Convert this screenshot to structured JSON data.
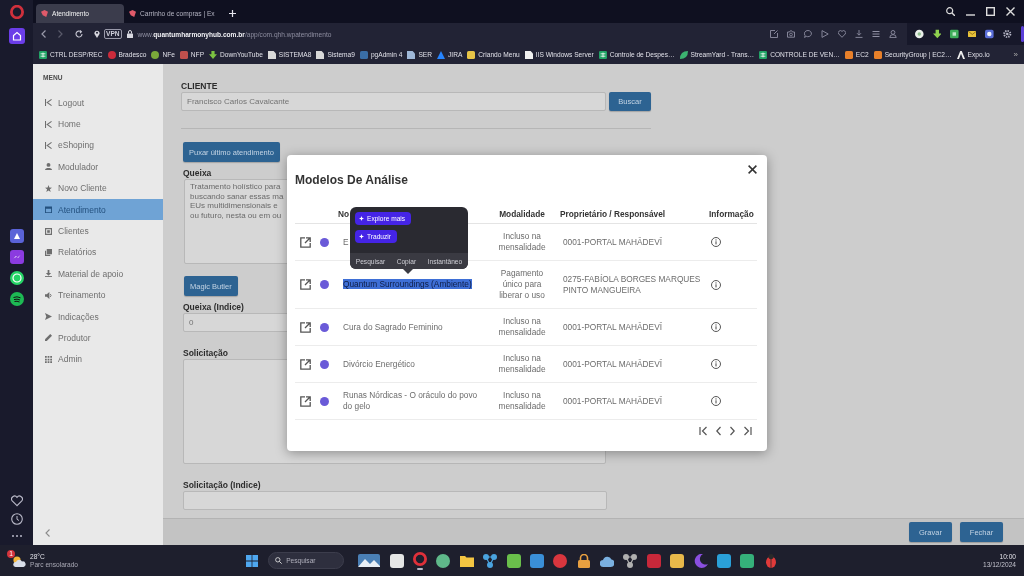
{
  "browser": {
    "tabs": [
      {
        "title": "Atendimento",
        "selected": true
      },
      {
        "title": "Carrinho de compras | Ex",
        "selected": false
      }
    ],
    "vpn": "VPN",
    "url": "www.**quantumharmonyhub.com.br**/app/com.qhh.wpatendimento",
    "bookmarks": [
      {
        "label": "CTRL DESP/REC",
        "kind": "sheet",
        "color": "#21a366"
      },
      {
        "label": "Bradesco",
        "kind": "disc",
        "color": "#cc2b3b"
      },
      {
        "label": "NFe",
        "kind": "disc",
        "color": "#7aa83a"
      },
      {
        "label": "NFP",
        "kind": "tile",
        "color": "#c0504d"
      },
      {
        "label": "DownYouTube",
        "kind": "arrow",
        "color": "#7cc242"
      },
      {
        "label": "SISTEMA8",
        "kind": "doc",
        "color": "#d8d8d8"
      },
      {
        "label": "Sistema9",
        "kind": "doc",
        "color": "#d8d8d8"
      },
      {
        "label": "pgAdmin 4",
        "kind": "tile",
        "color": "#3a6ea8"
      },
      {
        "label": "SER",
        "kind": "doc",
        "color": "#9fb8d8"
      },
      {
        "label": "JIRA",
        "kind": "triangle",
        "color": "#2684ff"
      },
      {
        "label": "Criando Menu",
        "kind": "tile",
        "color": "#e8c547"
      },
      {
        "label": "IIS Windows Server",
        "kind": "doc",
        "color": "#f0f0f0"
      },
      {
        "label": "Controle de Despes…",
        "kind": "sheet",
        "color": "#21a366"
      },
      {
        "label": "StreamYard - Trans…",
        "kind": "leaf",
        "color": "#3cb371"
      },
      {
        "label": "CONTROLE DE VEN…",
        "kind": "sheet",
        "color": "#21a366"
      },
      {
        "label": "EC2",
        "kind": "tile",
        "color": "#e8802a"
      },
      {
        "label": "SecurityGroup | EC2…",
        "kind": "tile",
        "color": "#e8802a"
      },
      {
        "label": "Expo.io",
        "kind": "caret",
        "color": "#eeeeee"
      }
    ],
    "more": "»"
  },
  "menu": {
    "title": "MENU",
    "items": [
      {
        "label": "Logout",
        "kind": "exit",
        "selected": false
      },
      {
        "label": "Home",
        "kind": "exit",
        "selected": false
      },
      {
        "label": "eShoping",
        "kind": "exit",
        "selected": false
      },
      {
        "label": "Modulador",
        "kind": "user",
        "selected": false
      },
      {
        "label": "Novo Cliente",
        "kind": "star",
        "selected": false
      },
      {
        "label": "Atendimento",
        "kind": "calendar",
        "selected": true
      },
      {
        "label": "Clientes",
        "kind": "card",
        "selected": false
      },
      {
        "label": "Relatórios",
        "kind": "copy",
        "selected": false
      },
      {
        "label": "Material de apoio",
        "kind": "download",
        "selected": false
      },
      {
        "label": "Treinamento",
        "kind": "speaker",
        "selected": false
      },
      {
        "label": "Indicações",
        "kind": "send",
        "selected": false
      },
      {
        "label": "Produtor",
        "kind": "pencil",
        "selected": false
      },
      {
        "label": "Admin",
        "kind": "grid",
        "selected": false
      }
    ]
  },
  "form": {
    "client": {
      "label": "CLIENTE",
      "value": "Francisco Carlos Cavalcante",
      "button": "Buscar"
    },
    "last_visit_button": "Puxar último atendimento",
    "complaint": {
      "label": "Queixa",
      "lines": [
        "Tratamento holístico para",
        "buscando sanar essas ma",
        "EUs multidimensionais e",
        "ou futuro, nesta ou em ou"
      ]
    },
    "magic_button": "Magic Butler",
    "complaint_index": {
      "label": "Queixa (Indice)",
      "value": "0"
    },
    "request": {
      "label": "Solicitação"
    },
    "request_index": {
      "label": "Solicitação (Indice)"
    }
  },
  "footer": {
    "buttons": [
      "Gravar",
      "Fechar"
    ]
  },
  "modal": {
    "title": "Modelos De Análise",
    "columns": [
      "No",
      "Modalidade",
      "Proprietário / Responsável",
      "Informação"
    ],
    "rows": [
      {
        "name": "E",
        "modality": "Incluso na mensalidade",
        "owner": "0001-PORTAL MAHĀDEVĪ",
        "highlighted": false
      },
      {
        "name": "Quantum Surroundings (Ambiente)",
        "modality": "Pagamento único para liberar o uso",
        "owner": "0275-FABÍOLA BORGES MARQUES PINTO MANGUEIRA",
        "highlighted": true
      },
      {
        "name": "Cura do Sagrado Feminino",
        "modality": "Incluso na mensalidade",
        "owner": "0001-PORTAL MAHĀDEVĪ",
        "highlighted": false
      },
      {
        "name": "Divórcio Energético",
        "modality": "Incluso na mensalidade",
        "owner": "0001-PORTAL MAHĀDEVĪ",
        "highlighted": false
      },
      {
        "name": "Runas Nórdicas - O oráculo do povo do gelo",
        "modality": "Incluso na mensalidade",
        "owner": "0001-PORTAL MAHĀDEVĪ",
        "highlighted": false
      }
    ]
  },
  "popup": {
    "actions": [
      "Explore mais",
      "Traduzir"
    ],
    "options": [
      "Pesquisar",
      "Copiar",
      "Instantâneo"
    ]
  },
  "taskbar": {
    "weather": {
      "badge": "1",
      "temperature": "28°C",
      "condition": "Parc ensolarado"
    },
    "search": {
      "placeholder": "Pesquisar"
    },
    "apps": [
      {
        "kind": "landscape",
        "color": "#4a7fb5",
        "running": false
      },
      {
        "kind": "tile",
        "color": "#e6e6e6",
        "running": false
      },
      {
        "kind": "ring",
        "color": "#e0303a",
        "running": true
      },
      {
        "kind": "disc",
        "color": "#5fb88a",
        "running": false
      },
      {
        "kind": "folder",
        "color": "#f4c542",
        "running": false
      },
      {
        "kind": "nodes",
        "color": "#4aa3df",
        "running": false
      },
      {
        "kind": "tile",
        "color": "#6abf4b",
        "running": false
      },
      {
        "kind": "tile",
        "color": "#3a8fd8",
        "running": false
      },
      {
        "kind": "disc",
        "color": "#d9363e",
        "running": false
      },
      {
        "kind": "lock",
        "color": "#e8a040",
        "running": false
      },
      {
        "kind": "cloud",
        "color": "#7ab0e0",
        "running": false
      },
      {
        "kind": "nodes",
        "color": "#b0b0b0",
        "running": false
      },
      {
        "kind": "tile",
        "color": "#c8283a",
        "running": false
      },
      {
        "kind": "tile",
        "color": "#e8b84a",
        "running": false
      },
      {
        "kind": "moon",
        "color": "#8a4fe0",
        "running": false
      },
      {
        "kind": "tile",
        "color": "#2aa0d8",
        "running": false
      },
      {
        "kind": "tile",
        "color": "#35b07a",
        "running": false
      },
      {
        "kind": "bug",
        "color": "#e03a3a",
        "running": false
      }
    ],
    "clock": {
      "time": "10:00",
      "date": "13/12/2024"
    }
  }
}
